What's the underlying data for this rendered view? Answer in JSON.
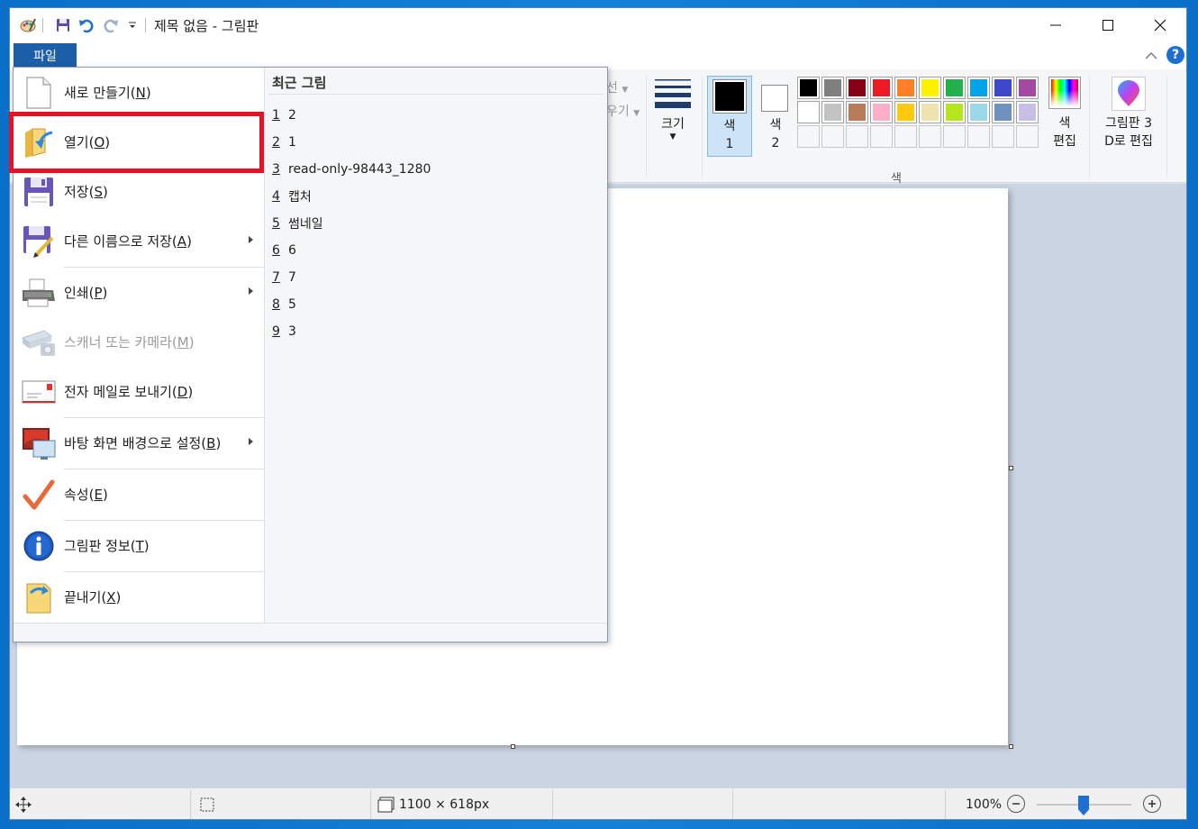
{
  "window": {
    "title": "제목 없음 - 그림판"
  },
  "ribbon": {
    "file_tab": "파일",
    "partial_outline": "선",
    "partial_fill": "우기",
    "size_label": "크기",
    "color1_label": "색",
    "color1_num": "1",
    "color2_label": "색",
    "color2_num": "2",
    "edit_colors_line1": "색",
    "edit_colors_line2": "편집",
    "paint3d_line1": "그림판 3",
    "paint3d_line2": "D로 편집",
    "colors_group_label": "색",
    "palette_row1": [
      "#000000",
      "#7f7f7f",
      "#880015",
      "#ed1c24",
      "#ff7f27",
      "#fff200",
      "#22b14c",
      "#00a2e8",
      "#3f48cc",
      "#a349a4"
    ],
    "palette_row2": [
      "#ffffff",
      "#c3c3c3",
      "#b97a57",
      "#ffaec9",
      "#ffc90e",
      "#efe4b0",
      "#b5e61d",
      "#99d9ea",
      "#7092be",
      "#c8bfe7"
    ]
  },
  "file_menu": {
    "items": [
      {
        "label": "새로 만들기(",
        "key": "N"
      },
      {
        "label": "열기(",
        "key": "O"
      },
      {
        "label": "저장(",
        "key": "S"
      },
      {
        "label": "다른 이름으로 저장(",
        "key": "A"
      },
      {
        "label": "인쇄(",
        "key": "P"
      },
      {
        "label": "스캐너 또는 카메라(",
        "key": "M"
      },
      {
        "label": "전자 메일로 보내기(",
        "key": "D"
      },
      {
        "label": "바탕 화면 배경으로 설정(",
        "key": "B"
      },
      {
        "label": "속성(",
        "key": "E"
      },
      {
        "label": "그림판 정보(",
        "key": "T"
      },
      {
        "label": "끝내기(",
        "key": "X"
      }
    ],
    "close_paren": ")",
    "recent_title": "최근 그림",
    "recent": [
      {
        "num": "1",
        "name": "2"
      },
      {
        "num": "2",
        "name": "1"
      },
      {
        "num": "3",
        "name": "read-only-98443_1280"
      },
      {
        "num": "4",
        "name": "캡처"
      },
      {
        "num": "5",
        "name": "썸네일"
      },
      {
        "num": "6",
        "name": "6"
      },
      {
        "num": "7",
        "name": "7"
      },
      {
        "num": "8",
        "name": "5"
      },
      {
        "num": "9",
        "name": "3"
      }
    ]
  },
  "statusbar": {
    "image_size": "1100 × 618px",
    "zoom": "100%",
    "zoom_level": 1.0
  },
  "colors": {
    "accent": "#1c5fa8",
    "highlight": "#e81123"
  }
}
